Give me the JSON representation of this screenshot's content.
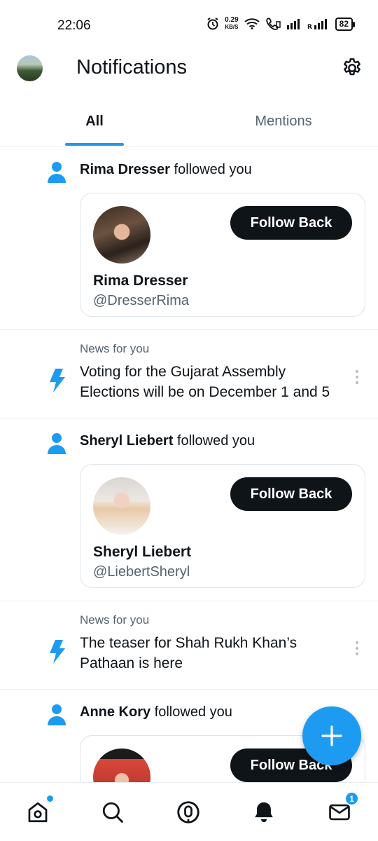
{
  "status_bar": {
    "time": "22:06",
    "net_speed_value": "0.29",
    "net_speed_unit": "KB/S",
    "battery": "82",
    "icons": [
      "alarm-icon",
      "wifi-icon",
      "volte-call-icon",
      "signal-icon",
      "roaming-signal-icon",
      "battery-icon"
    ]
  },
  "header": {
    "title": "Notifications",
    "settings_icon": "gear-icon"
  },
  "tabs": [
    {
      "label": "All",
      "active": true
    },
    {
      "label": "Mentions",
      "active": false
    }
  ],
  "notifications": [
    {
      "type": "follow",
      "name": "Rima Dresser",
      "action": " followed you",
      "handle": "@DresserRima",
      "button": "Follow Back"
    },
    {
      "type": "news",
      "label": "News for you",
      "text": "Voting for the Gujarat Assembly Elections will be on December 1 and 5"
    },
    {
      "type": "follow",
      "name": "Sheryl Liebert",
      "action": " followed you",
      "handle": "@LiebertSheryl",
      "button": "Follow Back"
    },
    {
      "type": "news",
      "label": "News for you",
      "text": "The teaser for Shah Rukh Khan’s Pathaan is here"
    },
    {
      "type": "follow",
      "name": "Anne Kory",
      "action": " followed you",
      "handle": "",
      "button": "Follow Back"
    }
  ],
  "bottom_nav": {
    "items": [
      "home-icon",
      "search-icon",
      "spaces-icon",
      "notifications-bell-icon",
      "messages-icon"
    ],
    "messages_badge": "1"
  },
  "colors": {
    "accent": "#1d9bf0",
    "text_primary": "#0f1419",
    "text_secondary": "#536471",
    "button_dark": "#0f1419"
  }
}
